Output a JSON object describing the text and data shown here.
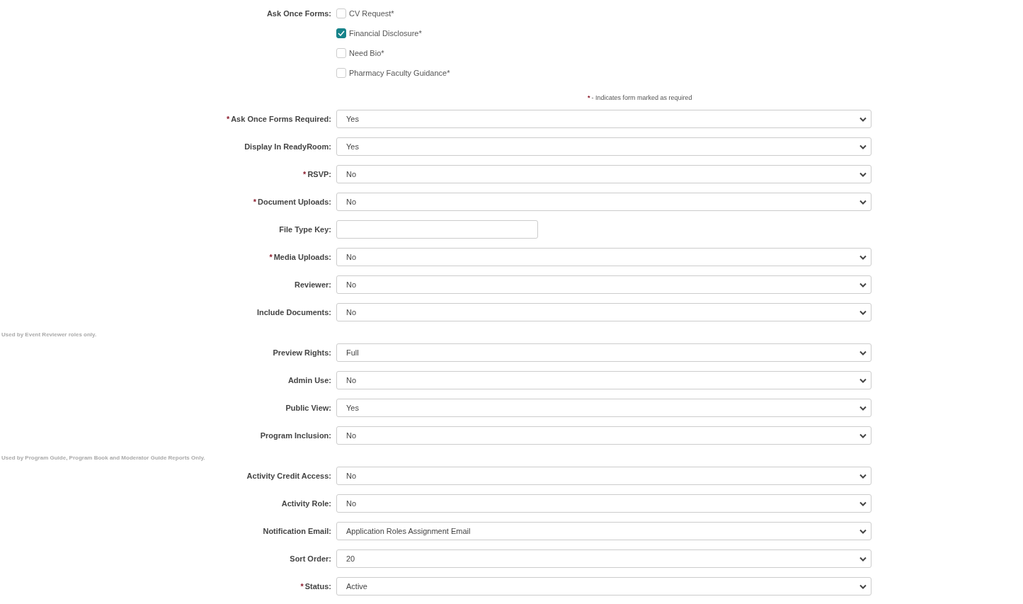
{
  "ask_once_forms": {
    "label": "Ask Once Forms:",
    "options": [
      {
        "label": "CV Request*",
        "checked": false
      },
      {
        "label": "Financial Disclosure*",
        "checked": true
      },
      {
        "label": "Need Bio*",
        "checked": false
      },
      {
        "label": "Pharmacy Faculty Guidance*",
        "checked": false
      }
    ]
  },
  "legend": {
    "mark": "*",
    "text": "- Indicates form marked as required"
  },
  "rows": [
    {
      "kind": "select",
      "required_mark": "*",
      "label": "Ask Once Forms Required:",
      "value": "Yes"
    },
    {
      "kind": "select",
      "label": "Display In ReadyRoom:",
      "value": "Yes"
    },
    {
      "kind": "select",
      "required_mark": "*",
      "label": "RSVP:",
      "value": "No"
    },
    {
      "kind": "select",
      "required_mark": "*",
      "label": "Document Uploads:",
      "value": "No"
    },
    {
      "kind": "text",
      "label": "File Type Key:"
    },
    {
      "kind": "select",
      "required_mark": "*",
      "label": "Media Uploads:",
      "value": "No"
    },
    {
      "kind": "select",
      "label": "Reviewer:",
      "value": "No"
    },
    {
      "kind": "select",
      "label": "Include Documents:",
      "value": "No"
    },
    {
      "kind": "note",
      "text": "Used by Event Reviewer roles only."
    },
    {
      "kind": "select",
      "label": "Preview Rights:",
      "value": "Full"
    },
    {
      "kind": "select",
      "label": "Admin Use:",
      "value": "No"
    },
    {
      "kind": "select",
      "label": "Public View:",
      "value": "Yes"
    },
    {
      "kind": "select",
      "label": "Program Inclusion:",
      "value": "No"
    },
    {
      "kind": "note",
      "text": "Used by Program Guide, Program Book and Moderator Guide Reports Only."
    },
    {
      "kind": "select",
      "label": "Activity Credit Access:",
      "value": "No"
    },
    {
      "kind": "select",
      "label": "Activity Role:",
      "value": "No"
    },
    {
      "kind": "select",
      "label": "Notification Email:",
      "value": "Application Roles Assignment Email"
    },
    {
      "kind": "select",
      "label": "Sort Order:",
      "value": "20"
    },
    {
      "kind": "select",
      "required_mark": "*",
      "label": "Status:",
      "value": "Active"
    }
  ]
}
